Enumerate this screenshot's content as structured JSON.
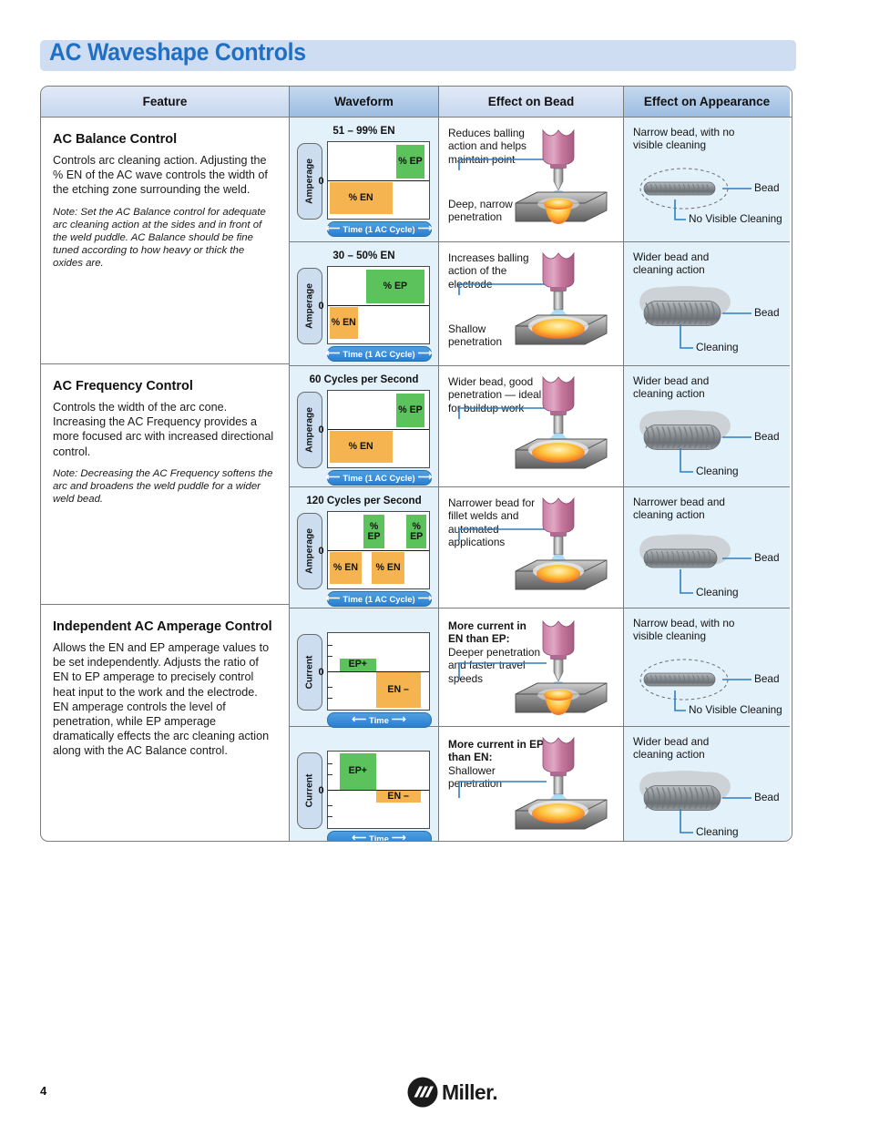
{
  "page": {
    "title": "AC Waveshape Controls",
    "page_number": "4",
    "logo_text": "Miller."
  },
  "table": {
    "headers": [
      "Feature",
      "Waveform",
      "Effect on Bead",
      "Effect on Appearance"
    ]
  },
  "features": [
    {
      "title": "AC Balance Control",
      "body": "Controls arc cleaning action. Adjusting the % EN of the AC wave controls the width of the etching zone surrounding the weld.",
      "note": "Note: Set the AC Balance control for adequate arc cleaning action at the sides and in front of the weld puddle. AC Balance should be fine tuned according to how heavy or thick the oxides are."
    },
    {
      "title": "AC Frequency Control",
      "body": "Controls the width of the arc cone. Increasing the AC Frequency provides a more focused arc with increased directional control.",
      "note": "Note: Decreasing the AC Frequency softens the arc and broadens the weld puddle for a wider weld bead."
    },
    {
      "title": "Independent AC Amperage Control",
      "body": "Allows the EN and EP amperage values to be set independently. Adjusts the ratio of EN to EP amperage to precisely control heat input to the work and the electrode. EN amperage controls the level of penetration, while EP amperage dramatically effects the arc cleaning action along with the AC Balance control.",
      "note": ""
    }
  ],
  "rows": [
    {
      "waveform": {
        "title": "51 – 99% EN",
        "axis_label": "Amperage",
        "zero_label": "0",
        "time_label": "Time (1 AC Cycle)",
        "ep_label": "% EP",
        "en_label": "% EN",
        "ticks": false
      },
      "bead": {
        "top_text": "Reduces balling action and helps maintain point",
        "bottom_text": "Deep, narrow penetration",
        "bold_lead": "",
        "style": "deep"
      },
      "appearance": {
        "heading": "Narrow bead, with no visible cleaning",
        "label_right": "Bead",
        "label_bottom": "No Visible Cleaning",
        "style": "narrow-dashed"
      }
    },
    {
      "waveform": {
        "title": "30 – 50% EN",
        "axis_label": "Amperage",
        "zero_label": "0",
        "time_label": "Time (1 AC Cycle)",
        "ep_label": "% EP",
        "en_label": "% EN",
        "ticks": false
      },
      "bead": {
        "top_text": "Increases balling action of the electrode",
        "bottom_text": "Shallow penetration",
        "bold_lead": "",
        "style": "shallow"
      },
      "appearance": {
        "heading": "Wider bead and cleaning action",
        "label_right": "Bead",
        "label_bottom": "Cleaning",
        "style": "wide-clean"
      }
    },
    {
      "waveform": {
        "title": "60 Cycles per Second",
        "axis_label": "Amperage",
        "zero_label": "0",
        "time_label": "Time (1 AC Cycle)",
        "ep_label": "% EP",
        "en_label": "% EN",
        "ticks": false
      },
      "bead": {
        "top_text": "Wider bead, good penetration — ideal for buildup work",
        "bottom_text": "",
        "bold_lead": "",
        "style": "shallow"
      },
      "appearance": {
        "heading": "Wider bead and cleaning action",
        "label_right": "Bead",
        "label_bottom": "Cleaning",
        "style": "wide-clean"
      }
    },
    {
      "waveform": {
        "title": "120 Cycles per Second",
        "axis_label": "Amperage",
        "zero_label": "0",
        "time_label": "Time (1 AC Cycle)",
        "ep_label": "% EP",
        "en_label": "% EN",
        "ticks": false
      },
      "bead": {
        "top_text": "Narrower bead for fillet welds and automated applications",
        "bottom_text": "",
        "bold_lead": "",
        "style": "shallow-narrow"
      },
      "appearance": {
        "heading": "Narrower bead and cleaning action",
        "label_right": "Bead",
        "label_bottom": "Cleaning",
        "style": "narrow-clean"
      }
    },
    {
      "waveform": {
        "title": "",
        "axis_label": "Current",
        "zero_label": "0",
        "time_label": "Time",
        "ep_label": "EP+",
        "en_label": "EN –",
        "ticks": true
      },
      "bead": {
        "bold_lead": "More current in EN than EP:",
        "top_text": "Deeper penetration and faster travel speeds",
        "bottom_text": "",
        "style": "deep"
      },
      "appearance": {
        "heading": "Narrow bead, with no visible cleaning",
        "label_right": "Bead",
        "label_bottom": "No Visible Cleaning",
        "style": "narrow-dashed"
      }
    },
    {
      "waveform": {
        "title": "",
        "axis_label": "Current",
        "zero_label": "0",
        "time_label": "Time",
        "ep_label": "EP+",
        "en_label": "EN –",
        "ticks": true
      },
      "bead": {
        "bold_lead": "More current in EP than EN:",
        "top_text": "Shallower penetration",
        "bottom_text": "",
        "style": "shallow"
      },
      "appearance": {
        "heading": "Wider bead and cleaning action",
        "label_right": "Bead",
        "label_bottom": "Cleaning",
        "style": "wide-clean"
      }
    }
  ],
  "colors": {
    "title_blue": "#1f6fc4",
    "banner_bg": "#cfddf2",
    "ep_green": "#5cc25c",
    "en_orange": "#f5b44f",
    "time_blue": "#2b7fd0",
    "panel_blue": "#e3f1fb",
    "leader_blue": "#2f7fc4"
  }
}
